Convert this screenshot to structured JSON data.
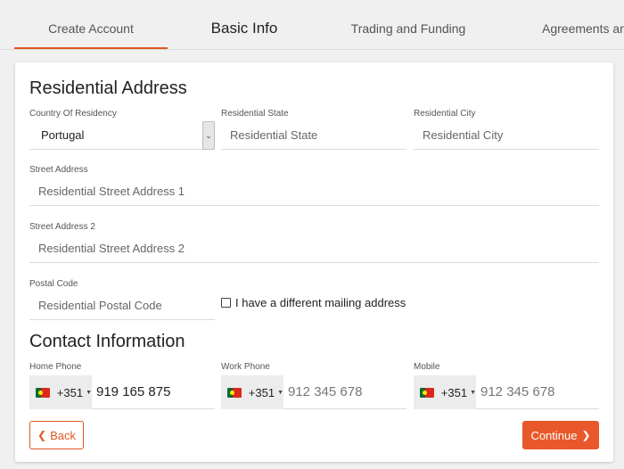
{
  "tabs": [
    {
      "label": "Create Account"
    },
    {
      "label": "Basic Info"
    },
    {
      "label": "Trading and Funding"
    },
    {
      "label": "Agreements and"
    }
  ],
  "residential": {
    "title": "Residential Address",
    "country_label": "Country Of Residency",
    "country_value": "Portugal",
    "state_label": "Residential State",
    "state_placeholder": "Residential State",
    "city_label": "Residential City",
    "city_placeholder": "Residential City",
    "street_label": "Street Address",
    "street_placeholder": "Residential Street Address 1",
    "street2_label": "Street Address 2",
    "street2_placeholder": "Residential Street Address 2",
    "postal_label": "Postal Code",
    "postal_placeholder": "Residential Postal Code",
    "mailing_checkbox_label": "I have a different mailing address",
    "mailing_checked": false
  },
  "contact": {
    "title": "Contact Information",
    "home_label": "Home Phone",
    "home_code": "+351",
    "home_value": "919 165 875",
    "work_label": "Work Phone",
    "work_code": "+351",
    "work_placeholder": "912 345 678",
    "mobile_label": "Mobile",
    "mobile_code": "+351",
    "mobile_placeholder": "912 345 678"
  },
  "buttons": {
    "back_label": "Back",
    "continue_label": "Continue"
  },
  "colors": {
    "accent": "#e2561f",
    "primary_button": "#e8582a"
  },
  "icons": {
    "select_arrow": "chevron-down-icon",
    "back": "chevron-left-icon",
    "continue": "chevron-right-icon",
    "flag": "portugal-flag-icon"
  }
}
